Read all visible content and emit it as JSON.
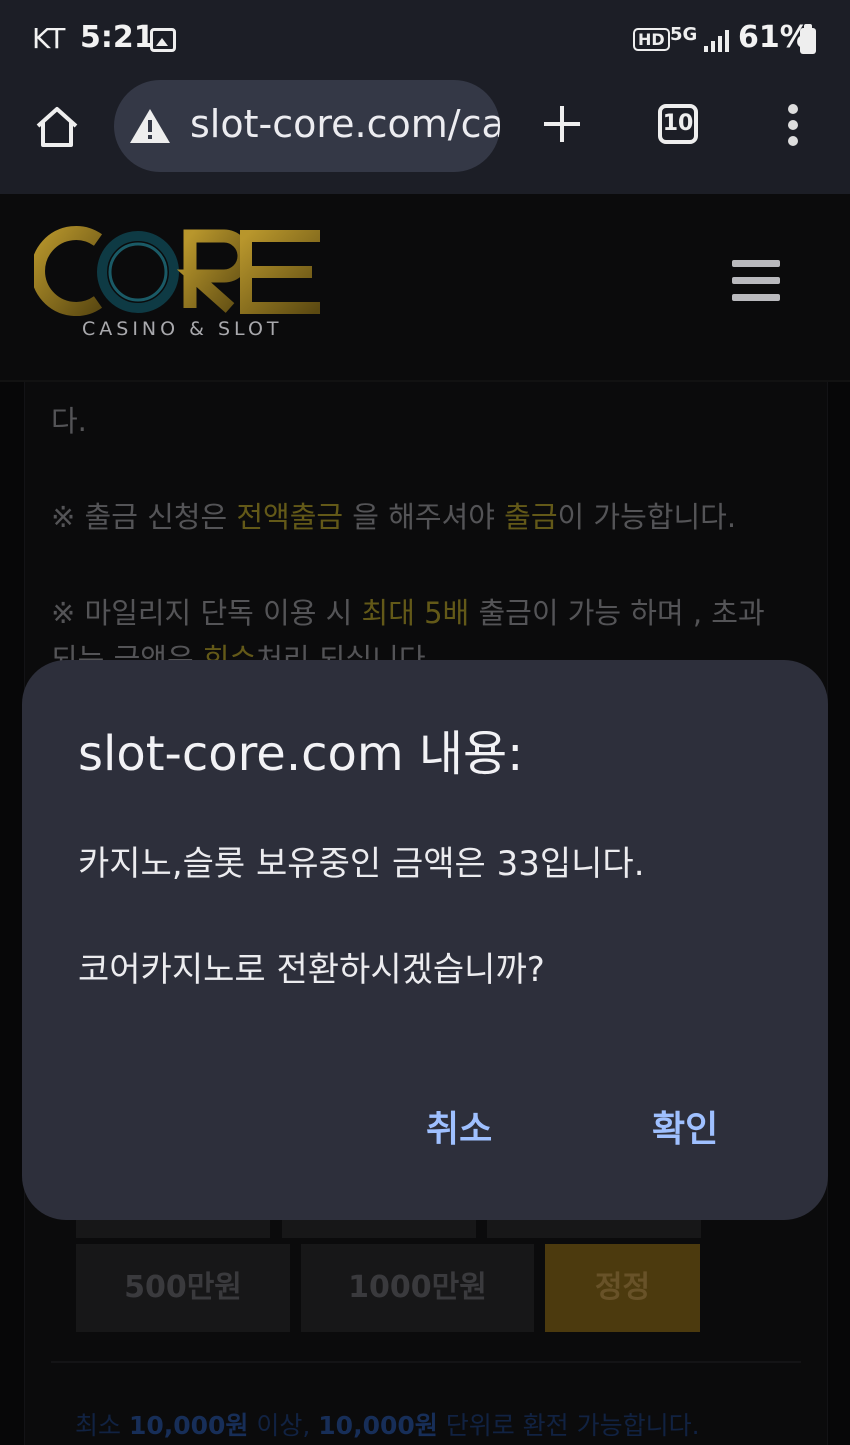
{
  "status_bar": {
    "carrier": "KT",
    "time": "5:21",
    "hd": "HD",
    "network": "5G",
    "battery": "61%"
  },
  "browser": {
    "url": "slot-core.com/casino"
  },
  "site": {
    "logo_text": "CORE",
    "logo_subtitle": "CASINO & SLOT"
  },
  "content": {
    "line0": "다.",
    "line1": {
      "a": "※ 출금 신청은 ",
      "b": "전액출금",
      "c": " 을 해주셔야 ",
      "d": "출금",
      "e": "이 가능합니다."
    },
    "line2": {
      "a": "※ 마일리지 단독 이용 시 ",
      "b": "최대 5배",
      "c": " 출금이 가능 하며 , 초과"
    },
    "line3": {
      "a": "되는 금액은 ",
      "b": "회수",
      "c": "처리 되십니다."
    },
    "amount_buttons": [
      "500만원",
      "1000만원"
    ],
    "confirm_label": "정정",
    "notice": {
      "a": "최소 ",
      "b": "10,000원",
      "c": " 이상, ",
      "d": "10,000원",
      "e": " 단위로 환전 가능합니다."
    }
  },
  "dialog": {
    "title": "slot-core.com 내용:",
    "message1": "카지노,슬롯 보유중인 금액은 33입니다.",
    "message2": "코어카지노로 전환하시겠습니까?",
    "cancel": "취소",
    "ok": "확인"
  },
  "colors": {
    "highlight": "#b5a22c",
    "dialog_bg": "#2d2f3b",
    "dialog_button": "#9fc0ff",
    "confirm_bg": "#8a6a1a"
  }
}
